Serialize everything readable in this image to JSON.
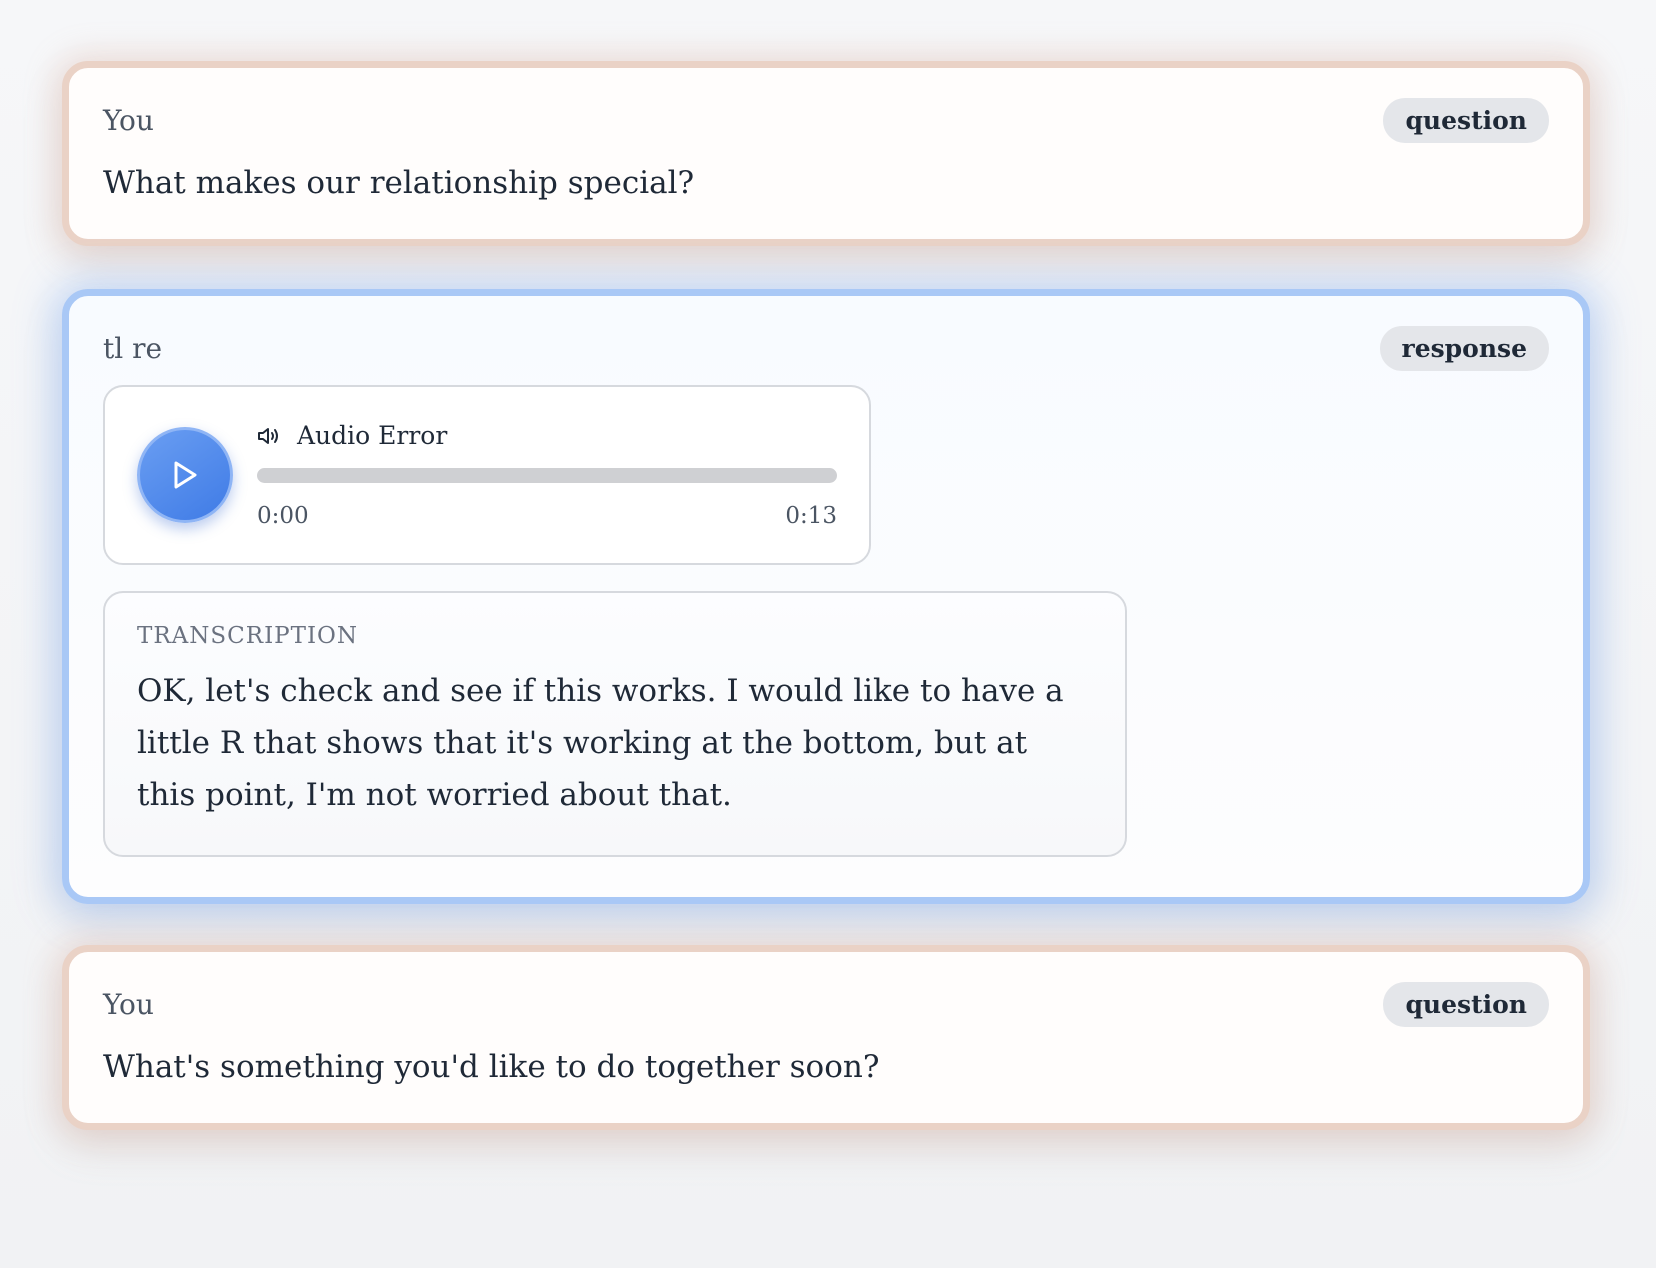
{
  "messages": [
    {
      "author": "You",
      "badge": "question",
      "text": "What makes our relationship special?"
    },
    {
      "author": "tl re",
      "badge": "response",
      "audio": {
        "status": "Audio Error",
        "current_time": "0:00",
        "duration": "0:13",
        "progress": 0
      },
      "transcription": {
        "label": "TRANSCRIPTION",
        "text": "OK, let's check and see if this works. I would like to have a little R that shows that it's working at the bottom, but at this point, I'm not worried about that."
      }
    },
    {
      "author": "You",
      "badge": "question",
      "text": "What's something you'd like to do together soon?"
    }
  ],
  "colors": {
    "question_border": "#ead2c6",
    "response_border": "#a9c8f6",
    "play_button": "#4a86ea",
    "badge_bg": "#e4e6ea"
  },
  "icons": [
    "play-icon",
    "speaker-icon"
  ]
}
